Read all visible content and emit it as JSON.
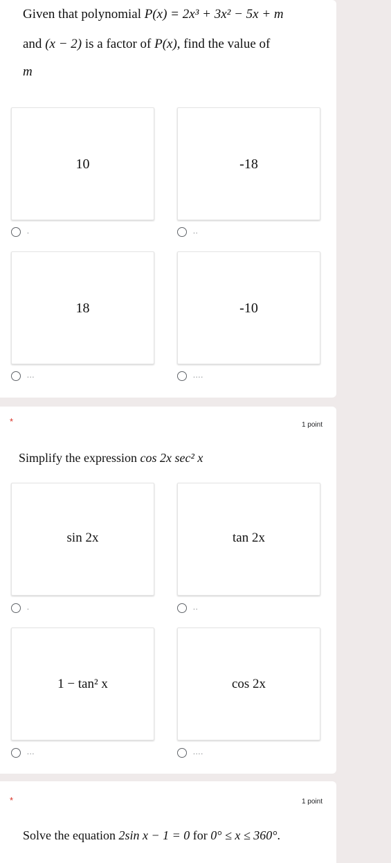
{
  "question1": {
    "line1_prefix": "Given that polynomial ",
    "line1_math": "P(x) = 2x³ + 3x² − 5x + m",
    "line2_prefix": "and ",
    "line2_factor": "(x − 2)",
    "line2_mid": " is a factor of ",
    "line2_px": "P(x)",
    "line2_suffix": ", find the value of",
    "line3_math": "m",
    "options": [
      {
        "label": "10",
        "mark": "."
      },
      {
        "label": "-18",
        "mark": ".."
      },
      {
        "label": "18",
        "mark": "..."
      },
      {
        "label": "-10",
        "mark": "...."
      }
    ]
  },
  "question2": {
    "required": "*",
    "points": "1 point",
    "prefix": "Simplify the expression ",
    "expr": "cos 2x sec² x",
    "options": [
      {
        "label": "sin 2x",
        "mark": "."
      },
      {
        "label": "tan 2x",
        "mark": ".."
      },
      {
        "label": "1 − tan² x",
        "mark": "..."
      },
      {
        "label": "cos 2x",
        "mark": "...."
      }
    ]
  },
  "question3": {
    "required": "*",
    "points": "1 point",
    "prefix": "Solve the equation ",
    "equation": "2sin x − 1 = 0",
    "mid": " for ",
    "range": "0° ≤ x ≤ 360°",
    "suffix": "."
  }
}
